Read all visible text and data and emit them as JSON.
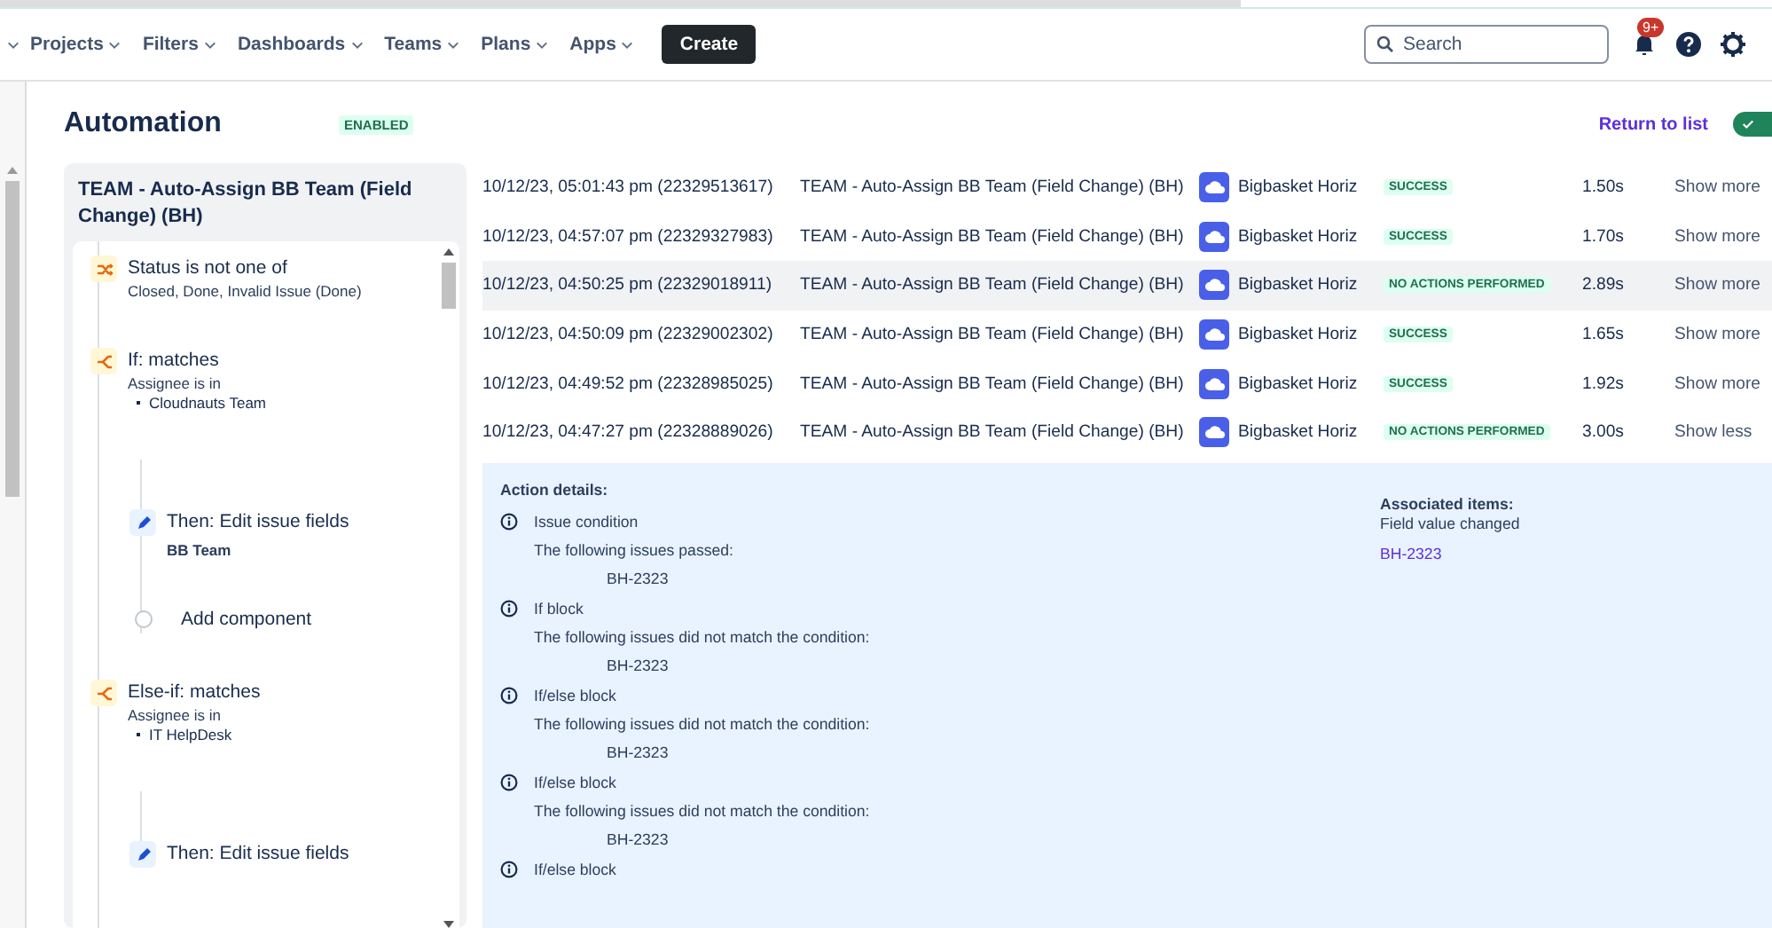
{
  "nav": {
    "items": [
      "Projects",
      "Filters",
      "Dashboards",
      "Teams",
      "Plans",
      "Apps"
    ],
    "create": "Create",
    "search": {
      "placeholder": "Search"
    },
    "notifications": "9+"
  },
  "header": {
    "title": "Automation",
    "badge": "ENABLED",
    "return_link": "Return to list",
    "toggle": {
      "on": true
    }
  },
  "rule": {
    "title": "TEAM - Auto-Assign BB Team (Field Change) (BH)",
    "components": [
      {
        "kind": "condition",
        "title": "Status is not one of",
        "detail": "Closed, Done, Invalid Issue (Done)"
      },
      {
        "kind": "branch",
        "title": "If: matches",
        "detail": "Assignee is in",
        "bullets": [
          "Cloudnauts Team"
        ],
        "children": [
          {
            "kind": "action",
            "title": "Then: Edit issue fields",
            "detail": "BB Team"
          },
          {
            "kind": "add",
            "title": "Add component"
          }
        ]
      },
      {
        "kind": "branch",
        "title": "Else-if: matches",
        "detail": "Assignee is in",
        "bullets": [
          "IT HelpDesk"
        ],
        "children": [
          {
            "kind": "action",
            "title": "Then: Edit issue fields"
          }
        ]
      }
    ]
  },
  "audit_log": {
    "rows": [
      {
        "time": "10/12/23, 05:01:43 pm (22329513617)",
        "rule": "TEAM - Auto-Assign BB Team (Field Change) (BH)",
        "actor": "Bigbasket Horiz",
        "status": "SUCCESS",
        "duration": "1.50s",
        "action": "Show more",
        "highlighted": false
      },
      {
        "time": "10/12/23, 04:57:07 pm (22329327983)",
        "rule": "TEAM - Auto-Assign BB Team (Field Change) (BH)",
        "actor": "Bigbasket Horiz",
        "status": "SUCCESS",
        "duration": "1.70s",
        "action": "Show more",
        "highlighted": false
      },
      {
        "time": "10/12/23, 04:50:25 pm (22329018911)",
        "rule": "TEAM - Auto-Assign BB Team (Field Change) (BH)",
        "actor": "Bigbasket Horiz",
        "status": "NO ACTIONS PERFORMED",
        "duration": "2.89s",
        "action": "Show more",
        "highlighted": true
      },
      {
        "time": "10/12/23, 04:50:09 pm (22329002302)",
        "rule": "TEAM - Auto-Assign BB Team (Field Change) (BH)",
        "actor": "Bigbasket Horiz",
        "status": "SUCCESS",
        "duration": "1.65s",
        "action": "Show more",
        "highlighted": false
      },
      {
        "time": "10/12/23, 04:49:52 pm (22328985025)",
        "rule": "TEAM - Auto-Assign BB Team (Field Change) (BH)",
        "actor": "Bigbasket Horiz",
        "status": "SUCCESS",
        "duration": "1.92s",
        "action": "Show more",
        "highlighted": false
      },
      {
        "time": "10/12/23, 04:47:27 pm (22328889026)",
        "rule": "TEAM - Auto-Assign BB Team (Field Change) (BH)",
        "actor": "Bigbasket Horiz",
        "status": "NO ACTIONS PERFORMED",
        "duration": "3.00s",
        "action": "Show less",
        "highlighted": false
      }
    ],
    "details": {
      "title": "Action details:",
      "entries": [
        {
          "title": "Issue condition",
          "message": "The following issues passed:",
          "issue": "BH-2323"
        },
        {
          "title": "If block",
          "message": "The following issues did not match the condition:",
          "issue": "BH-2323"
        },
        {
          "title": "If/else block",
          "message": "The following issues did not match the condition:",
          "issue": "BH-2323"
        },
        {
          "title": "If/else block",
          "message": "The following issues did not match the condition:",
          "issue": "BH-2323"
        },
        {
          "title": "If/else block"
        }
      ],
      "associated": {
        "title": "Associated items:",
        "subtitle": "Field value changed",
        "link": "BH-2323"
      }
    }
  }
}
